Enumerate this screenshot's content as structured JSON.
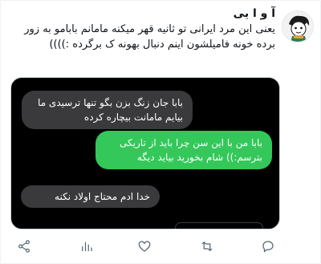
{
  "tweet": {
    "display_name": "آ و ا یی",
    "text": "یعنی این مرد ایرانی تو ثانیه قهر میکنه مامانم بابامو به زور برده خونه فامیلشون اینم دنبال بهونه ک برگرده :))))"
  },
  "media": {
    "messages": [
      {
        "side": "left",
        "color": "gray",
        "text": "بابا جان زنگ بزن بگو تنها ترسیدی ما بیایم مامانت بیچاره کرده"
      },
      {
        "side": "right",
        "color": "green",
        "text": "بابا من با این سن چرا باید از تاریکی بترسم:)) شام بخورید بیاید دیگه"
      },
      {
        "side": "left",
        "color": "gray",
        "text": "خدا ادم محتاج اولاد نکنه"
      }
    ]
  },
  "actions": [
    "share-icon",
    "views-icon",
    "like-icon",
    "retweet-icon",
    "reply-icon"
  ],
  "colors": {
    "bubble_gray": "#3a3a3c",
    "bubble_green": "#34c759",
    "icon": "#536471",
    "text": "#0f1419"
  }
}
